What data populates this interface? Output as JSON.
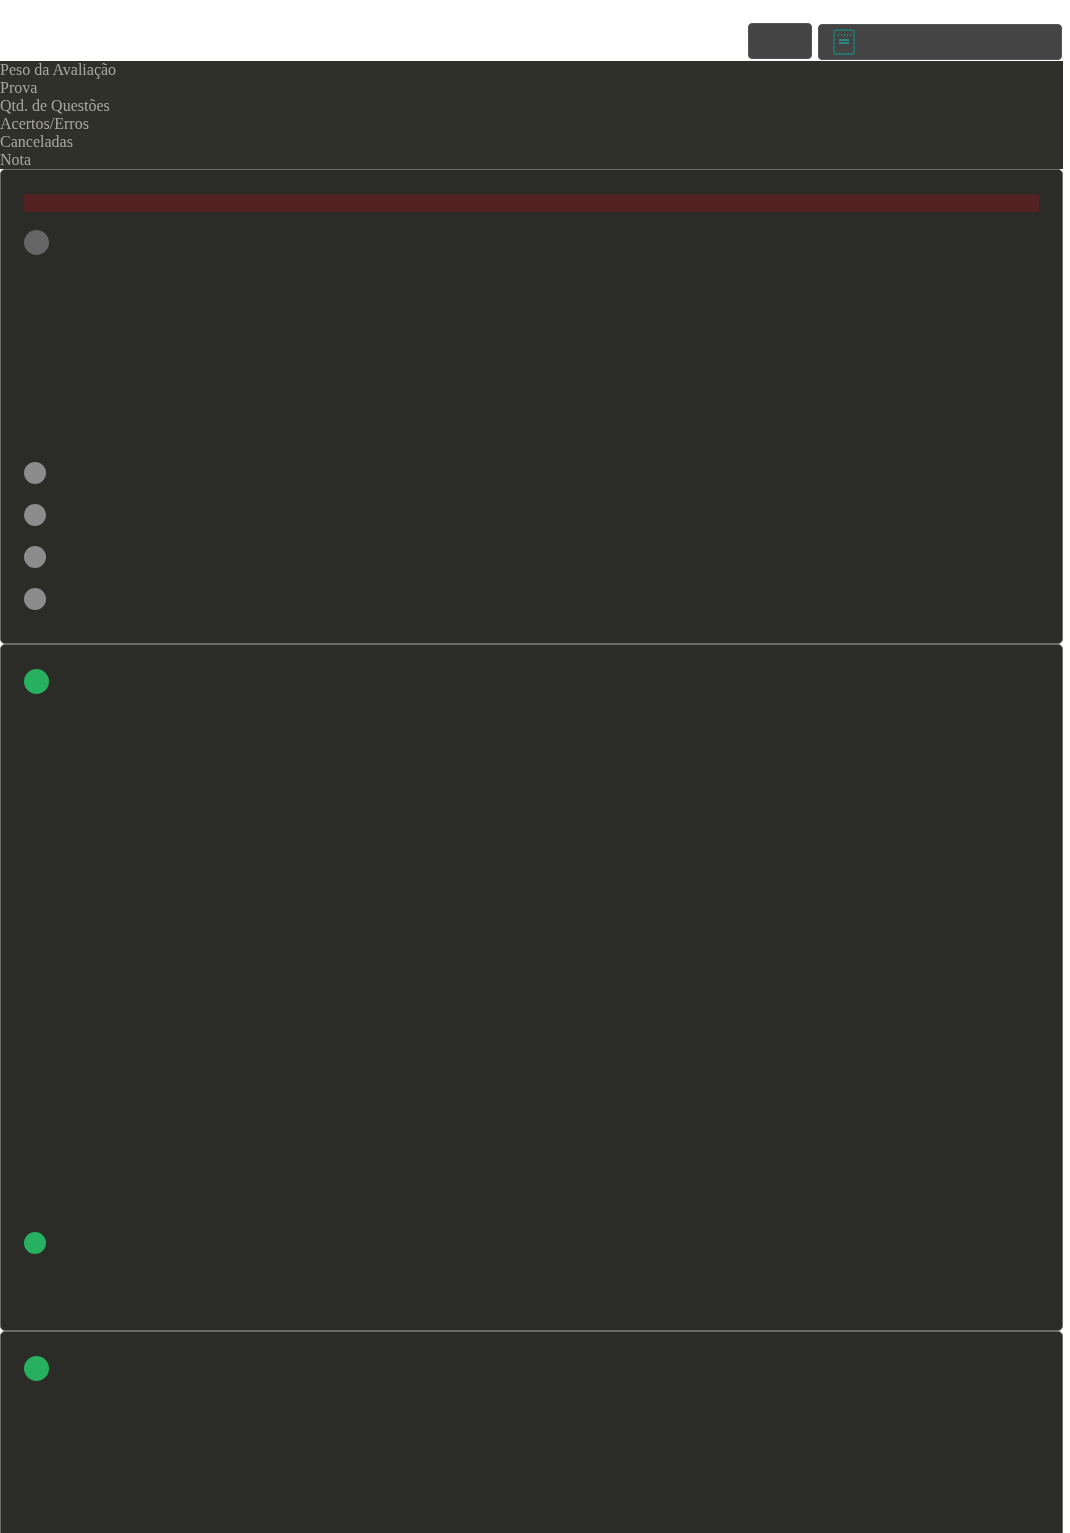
{
  "header_labels": [
    "Peso da Avaliação",
    "Prova",
    "Qtd. de Questões",
    "Acertos/Erros",
    "Canceladas",
    "Nota"
  ],
  "cards": [
    {
      "alert": true,
      "lead_marker": {
        "color": "#666666"
      },
      "markers": [
        {
          "color": "#8c8c8c"
        },
        {
          "color": "#8c8c8c"
        },
        {
          "color": "#8c8c8c"
        },
        {
          "color": "#8c8c8c"
        }
      ]
    },
    {
      "alert": false,
      "lead_marker": {
        "color": "#27b060"
      },
      "markers": [
        {
          "color": "#27b060"
        }
      ]
    },
    {
      "alert": false,
      "lead_marker": {
        "color": "#27b060"
      }
    }
  ]
}
